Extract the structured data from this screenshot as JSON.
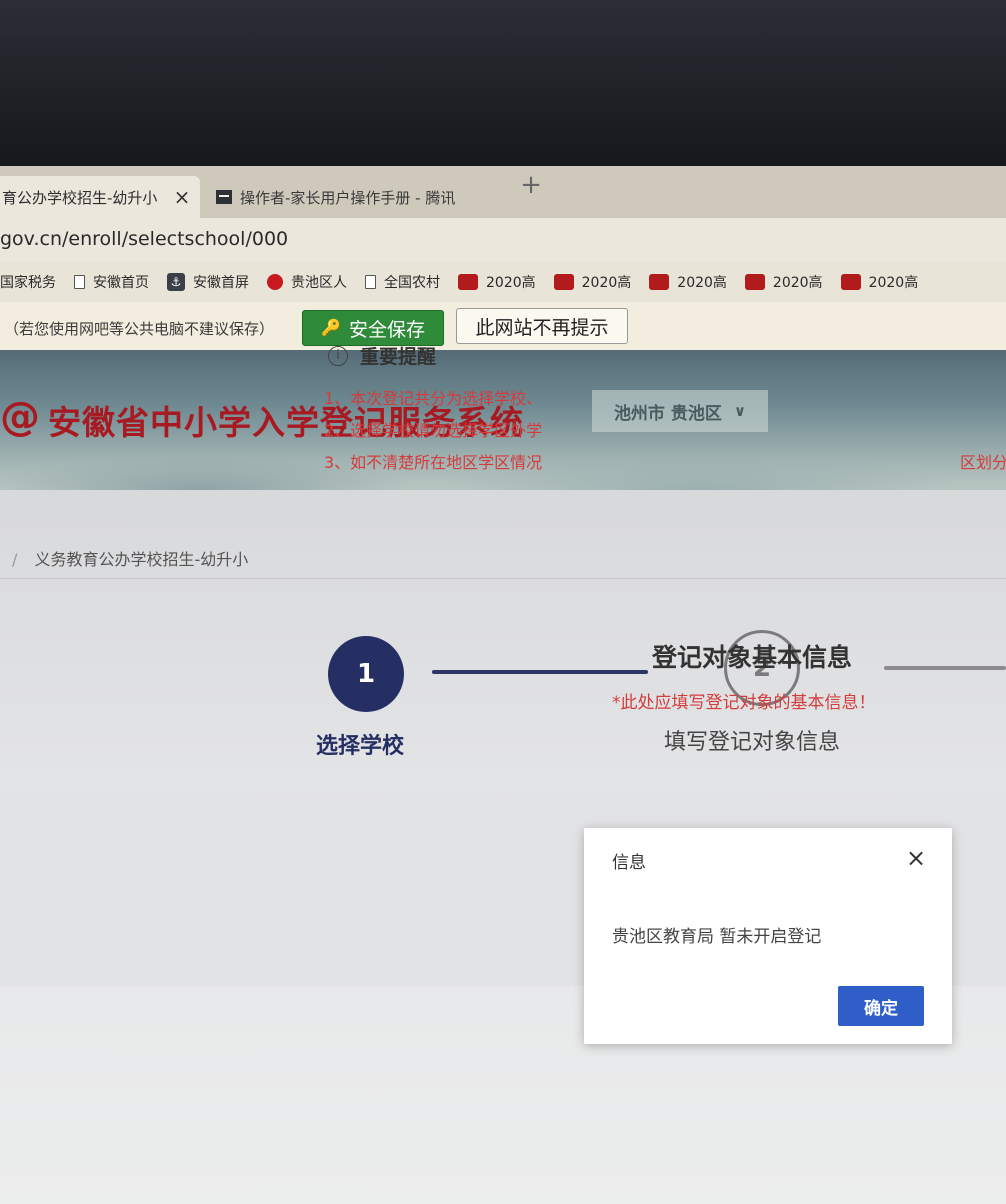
{
  "browser": {
    "tabs": [
      {
        "label": "育公办学校招生-幼升小",
        "close": "×"
      },
      {
        "label": "操作者-家长用户操作手册 - 腾讯"
      }
    ],
    "new_tab": "+",
    "url": "gov.cn/enroll/selectschool/000",
    "bookmarks": [
      {
        "label": "国家税务",
        "icon": "none"
      },
      {
        "label": "安徽首页",
        "icon": "doc-icon"
      },
      {
        "label": "安徽首屏",
        "icon": "anchor-icon"
      },
      {
        "label": "贵池区人",
        "icon": "red-emblem-icon"
      },
      {
        "label": "全国农村",
        "icon": "doc-icon"
      },
      {
        "label": "2020高",
        "icon": "badge-icon"
      },
      {
        "label": "2020高",
        "icon": "badge-icon"
      },
      {
        "label": "2020高",
        "icon": "badge-icon"
      },
      {
        "label": "2020高",
        "icon": "badge-icon"
      },
      {
        "label": "2020高",
        "icon": "badge-icon"
      }
    ],
    "password_bar": {
      "text": "（若您使用网吧等公共电脑不建议保存）",
      "save_label": "安全保存",
      "never_label": "此网站不再提示"
    }
  },
  "header": {
    "logo": "@",
    "title": "安徽省中小学入学登记服务系统",
    "region": "池州市 贵池区",
    "region_chevron": "∨"
  },
  "breadcrumb": {
    "separator": "/",
    "current": "义务教育公办学校招生-幼升小"
  },
  "steps": [
    {
      "number": "1",
      "label": "选择学校",
      "active": true
    },
    {
      "number": "2",
      "label": "填写登记对象信息",
      "active": false
    }
  ],
  "notice": {
    "icon": "i",
    "title": "重要提醒",
    "rules": [
      "1、本次登记共分为选择学校、",
      "2、选择学校请勿选择学区外学",
      "3、如不清楚所在地区学区情况"
    ],
    "rule3_tail": "区划分请"
  },
  "section": {
    "heading": "登记对象基本信息",
    "subtext": "*此处应填写登记对象的基本信息！"
  },
  "dialog": {
    "title": "信息",
    "close": "×",
    "message": "贵池区教育局 暂未开启登记",
    "ok_label": "确定"
  },
  "colors": {
    "accent_navy": "#262f63",
    "brand_red": "#a71a22",
    "warning_red": "#d43b3b",
    "save_green": "#2f8b3a",
    "dialog_button": "#2f5ec8"
  }
}
